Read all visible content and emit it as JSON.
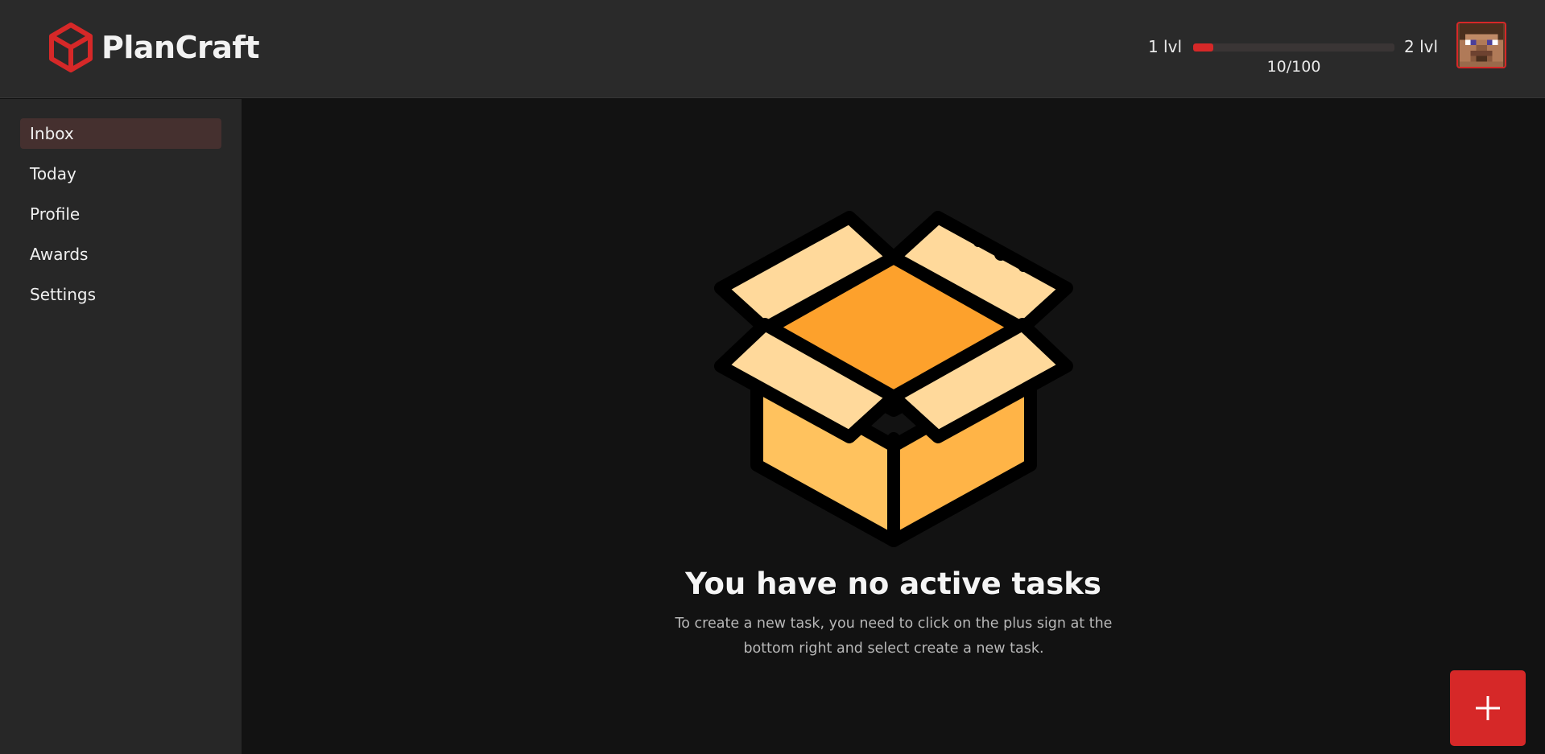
{
  "app": {
    "name": "PlanCraft",
    "brand_color": "#d62828",
    "logo_icon": "cube-icon"
  },
  "level": {
    "current_label": "1 lvl",
    "next_label": "2 lvl",
    "xp_text": "10/100",
    "progress_fraction": 0.1
  },
  "user": {
    "avatar_icon": "pixel-face-avatar"
  },
  "sidebar": {
    "items": [
      {
        "label": "Inbox",
        "active": true
      },
      {
        "label": "Today",
        "active": false
      },
      {
        "label": "Profile",
        "active": false
      },
      {
        "label": "Awards",
        "active": false
      },
      {
        "label": "Settings",
        "active": false
      }
    ]
  },
  "empty_state": {
    "illustration": "open-box-icon",
    "title": "You have no active tasks",
    "description": "To create a new task, you need to click on the plus sign at the bottom right and select create a new task."
  },
  "fab": {
    "icon": "plus-icon"
  }
}
